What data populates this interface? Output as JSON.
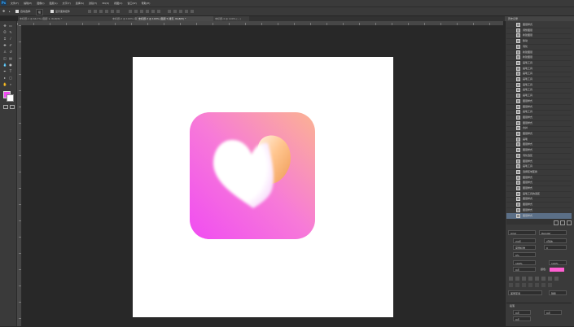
{
  "app": {
    "logo": "Ps",
    "accent": "#31a8ff"
  },
  "menu": [
    "文件(F)",
    "编辑(E)",
    "图像(I)",
    "图层(L)",
    "文字(Y)",
    "选择(S)",
    "滤镜(T)",
    "3D(D)",
    "视图(V)",
    "窗口(W)",
    "帮助(H)"
  ],
  "options": {
    "tool_preset": "▸",
    "auto_select": "自动选择:",
    "auto_select_target": "组",
    "transform_controls": "显示变换控件"
  },
  "tabs": [
    {
      "label": "未标题-1 @ 66.7% (图层 1, RGB/8) *",
      "active": false
    },
    {
      "label": "未标题-2 @ 100% (图层 2, RGB/8) *",
      "active": false
    },
    {
      "label": "未标题-3 @ 100% (图层 5 拷贝, RGB/8) *",
      "active": true
    },
    {
      "label": "未标题-4 @ 100% (...)",
      "active": false
    }
  ],
  "icon_colors": {
    "gradient_start": "#f04cf2",
    "gradient_mid": "#f77ad8",
    "gradient_end": "#fbb392"
  },
  "history": {
    "title": "历史记录",
    "items": [
      "图层样式",
      "调整图层",
      "新建图层",
      "移动",
      "羽化",
      "新建图层",
      "新建图层",
      "画笔工具",
      "画笔工具",
      "画笔工具",
      "画笔工具",
      "画笔工具",
      "画笔工具",
      "画笔工具",
      "图层样式",
      "图层样式",
      "画笔工具",
      "图层样式",
      "图层样式",
      "合并",
      "图层样式",
      "画笔",
      "图层样式",
      "图层样式",
      "羽化选区",
      "图层样式",
      "画笔工具",
      "选择区域变换",
      "图层样式",
      "图层样式",
      "图层样式",
      "画笔工具的选区",
      "图层样式",
      "图层样式",
      "图层样式",
      "图层样式"
    ],
    "selected_index": 35
  },
  "character": {
    "font_family": "Arial",
    "font_style": "Regular",
    "size": "24点",
    "leading": "(自动)",
    "kerning": "度量标准",
    "tracking": "0",
    "scale_percent": "0%",
    "vscale": "100%",
    "hscale": "100%",
    "baseline": "0点",
    "color_label": "颜色:",
    "color": "#ff5fd2",
    "language": "美国英语",
    "aa_method": "锐利"
  },
  "paragraph": {
    "title": "段落",
    "indent_left": "0点",
    "indent_right": "0点",
    "space_before": "0点"
  }
}
